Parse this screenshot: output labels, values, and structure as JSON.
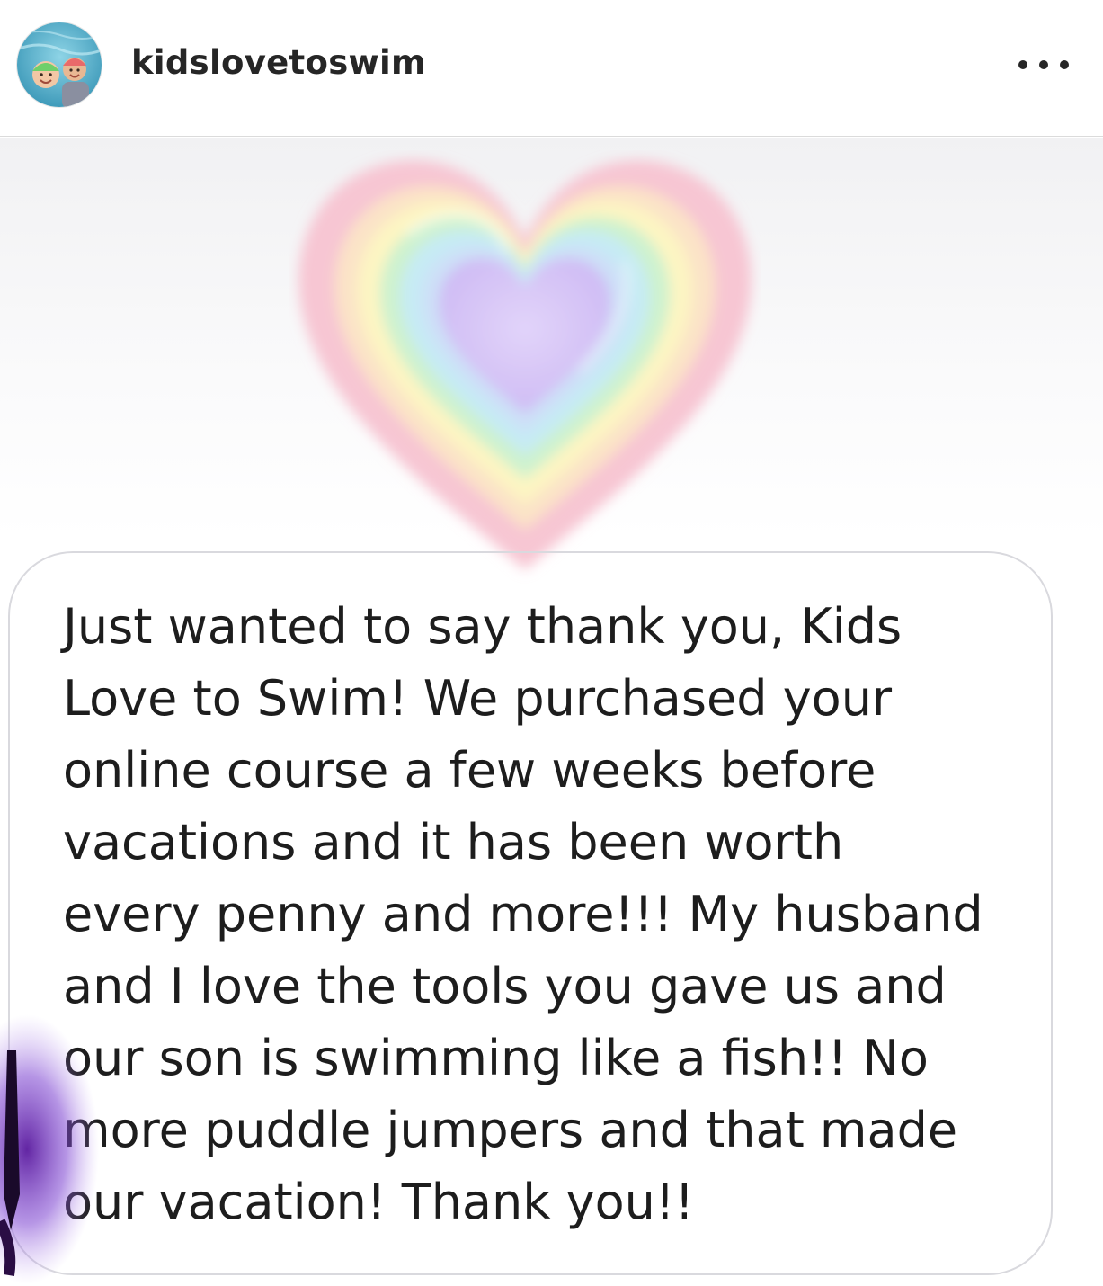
{
  "header": {
    "username": "kidslovetoswim",
    "more_icon": "ellipsis-horizontal-icon"
  },
  "post": {
    "message_lines": [
      "Just wanted to say thank you, Kids",
      "Love to Swim! We purchased your",
      "online course a few weeks before",
      "vacations and it has been worth",
      "every penny and more!!! My husband",
      "and I love the tools you gave us and",
      "our son is swimming like a fish!! No",
      "more puddle jumpers and that made",
      "our vacation! Thank you!!"
    ],
    "decoration_icon": "rainbow-heart-icon"
  },
  "colors": {
    "heart_outer": "#f7c9d4",
    "heart_yellow": "#fdf6c3",
    "heart_green": "#c9f1cf",
    "heart_cyan": "#c8ecf3",
    "heart_center": "#dcccf7",
    "text": "#1d1d1d",
    "bubble_border": "#d9d9de"
  }
}
